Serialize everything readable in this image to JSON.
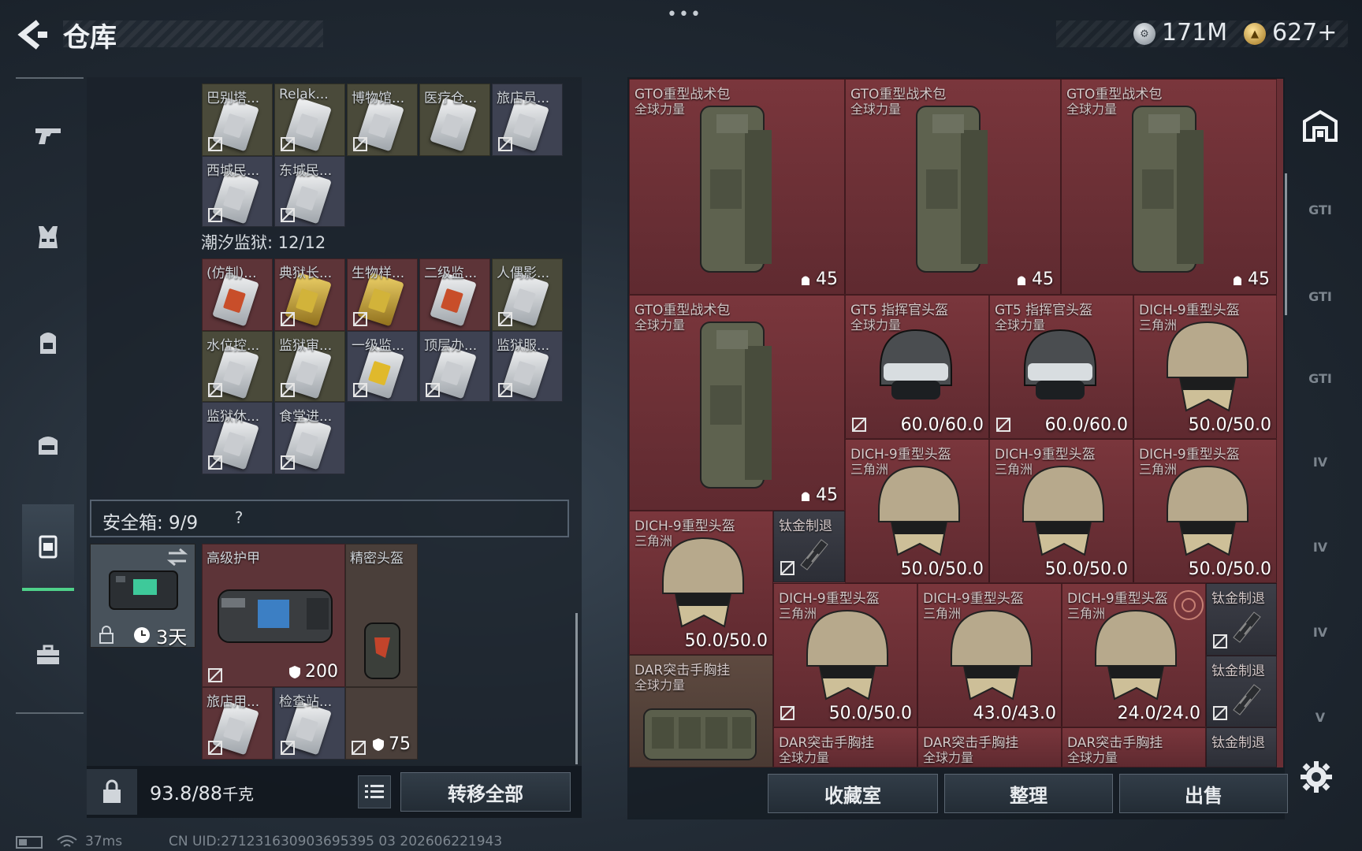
{
  "header": {
    "title": "仓库",
    "menu_dots": "•••",
    "silver_amount": "171M",
    "gold_amount": "627+"
  },
  "left": {
    "stash_row1": [
      "巴别塔...",
      "Relak...",
      "博物馆...",
      "医疗仓...",
      "旅店员..."
    ],
    "stash_row2": [
      "西城民...",
      "东城民..."
    ],
    "section_title": "潮汐监狱: 12/12",
    "prison_row1": [
      "(仿制)...",
      "典狱长...",
      "生物样...",
      "二级监...",
      "人偶影..."
    ],
    "prison_row2": [
      "水位控...",
      "监狱审...",
      "一级监...",
      "顶层办...",
      "监狱服..."
    ],
    "prison_row3": [
      "监狱休...",
      "食堂进..."
    ],
    "safe_label": "安全箱: 9/9",
    "safe_help": "?",
    "safe_timer": "3天",
    "armor_label": "高级护甲",
    "armor_value": "200",
    "precision_helmet_label": "精密头盔",
    "small_card1": "旅店用...",
    "small_card2": "检查站...",
    "small_value": "75",
    "weight_value": "93.8/88",
    "weight_unit": "千克",
    "transfer_all": "转移全部"
  },
  "right": {
    "backpack_name": "GTO重型战术包",
    "backpack_sub": "全球力量",
    "backpack_cap": "45",
    "gt5_name": "GT5 指挥官头盔",
    "gt5_sub": "全球力量",
    "gt5_dura": "60.0/60.0",
    "dich_name": "DICH-9重型头盔",
    "dich_sub": "三角洲",
    "dich_dura": "50.0/50.0",
    "dich_dura_43": "43.0/43.0",
    "dich_dura_24": "24.0/24.0",
    "titanium_name": "钛金制退",
    "dar_name": "DAR突击手胸挂",
    "dar_sub": "全球力量",
    "collection_btn": "收藏室",
    "sort_btn": "整理",
    "sell_btn": "出售",
    "filter_labels": [
      "GTI",
      "GTI",
      "GTI",
      "IV",
      "IV",
      "IV",
      "V"
    ]
  },
  "footer": {
    "latency": "37ms",
    "uid": "CN UID:271231630903695395 03 202606221943"
  },
  "colors": {
    "accent_green": "#4fd18a",
    "cell_red": "#6a2f35",
    "panel_dark": "#1a2129"
  }
}
